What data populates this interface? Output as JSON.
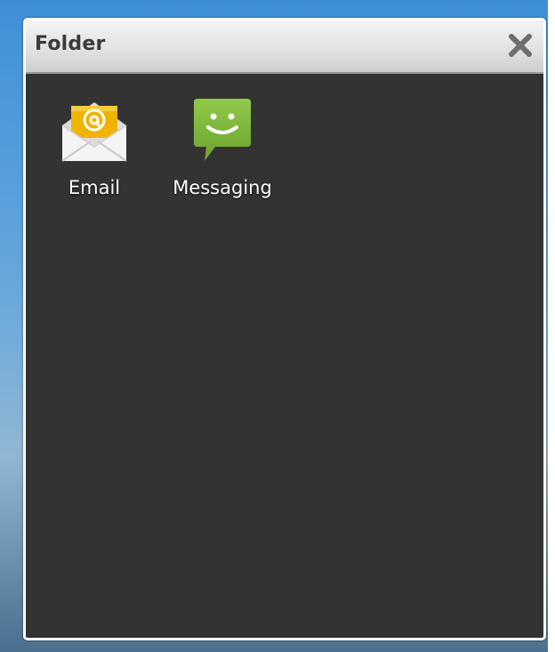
{
  "folder": {
    "title": "Folder",
    "close_icon": "close-x-icon"
  },
  "apps": [
    {
      "label": "Email",
      "icon": "email-envelope-icon"
    },
    {
      "label": "Messaging",
      "icon": "messaging-bubble-icon"
    }
  ],
  "colors": {
    "folder_background": "#333333",
    "title_bar": "#e2e2e2",
    "email_accent": "#f0b400",
    "messaging_accent": "#7fb43a"
  }
}
